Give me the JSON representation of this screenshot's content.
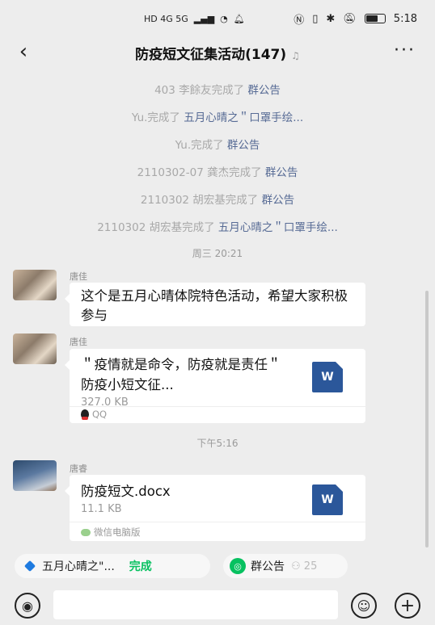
{
  "status": {
    "network": "HD 4G 5G",
    "time": "5:18"
  },
  "header": {
    "back_icon": "back-chevron-icon",
    "title": "防疫短文征集活动(147)",
    "mute_icon": "mute-bell-icon",
    "more_icon": "more-dots-icon"
  },
  "system_messages": [
    {
      "who": "403 李餘友完成了",
      "link": "群公告"
    },
    {
      "who": "Yu.完成了",
      "link": "五月心晴之＂口罩手绘..."
    },
    {
      "who": "Yu.完成了",
      "link": "群公告"
    },
    {
      "who": "2110302-07 龚杰完成了",
      "link": "群公告"
    },
    {
      "who": "2110302 胡宏基完成了",
      "link": "群公告"
    },
    {
      "who": "2110302 胡宏基完成了",
      "link": "五月心晴之＂口罩手绘..."
    }
  ],
  "timestamps": {
    "t1": "周三 20:21",
    "t2": "下午5:16"
  },
  "messages": {
    "m1": {
      "sender": "唐佳",
      "text": "这个是五月心晴体院特色活动，希望大家积极参与"
    },
    "m2": {
      "sender": "唐佳",
      "file_title": "＂疫情就是命令，防疫就是责任＂防疫小短文征...",
      "file_size": "327.0 KB",
      "file_icon": "W",
      "source": "QQ"
    },
    "m3": {
      "sender": "唐睿",
      "file_title": "防疫短文.docx",
      "file_size": "11.1 KB",
      "file_icon": "W",
      "source": "微信电脑版"
    }
  },
  "toolbar": {
    "task_label": "五月心晴之\"...",
    "task_status": "完成",
    "notice_label": "群公告",
    "notice_count": "25"
  },
  "inputbar": {
    "voice_icon": "voice-icon",
    "emoji_icon": "emoji-icon",
    "plus_icon": "plus-icon"
  }
}
